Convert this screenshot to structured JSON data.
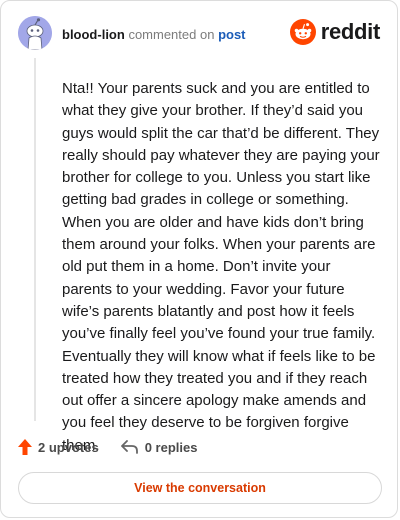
{
  "header": {
    "username": "blood-lion",
    "action_text": "commented on",
    "post_link": "post"
  },
  "brand": {
    "wordmark": "reddit",
    "color": "#ff4500"
  },
  "comment": {
    "body": "Nta!! Your parents suck and you are entitled to what they give your brother. If they’d said you guys would split the car that’d be different. They really should pay whatever they are paying your brother for college to you. Unless you start like getting bad grades in college or something. When you are older and have kids don’t bring them around your folks. When your parents are old put them in a home. Don’t invite your parents to your wedding. Favor your future wife’s parents blatantly and post how it feels you’ve finally feel you’ve found your true family. Eventually they will know what if feels like to be treated how they treated you and if they reach out offer a sincere apology make amends and you feel they deserve to be forgiven forgive them."
  },
  "actions": {
    "upvotes_label": "2 upvotes",
    "replies_label": "0 replies",
    "upvote_color": "#ff4500"
  },
  "cta": {
    "label": "View the conversation",
    "color": "#d93a00"
  },
  "icons": {
    "avatar": "snoo-avatar-icon",
    "brand": "reddit-logo-icon",
    "upvote": "upvote-arrow-icon",
    "reply": "reply-arrow-icon"
  }
}
